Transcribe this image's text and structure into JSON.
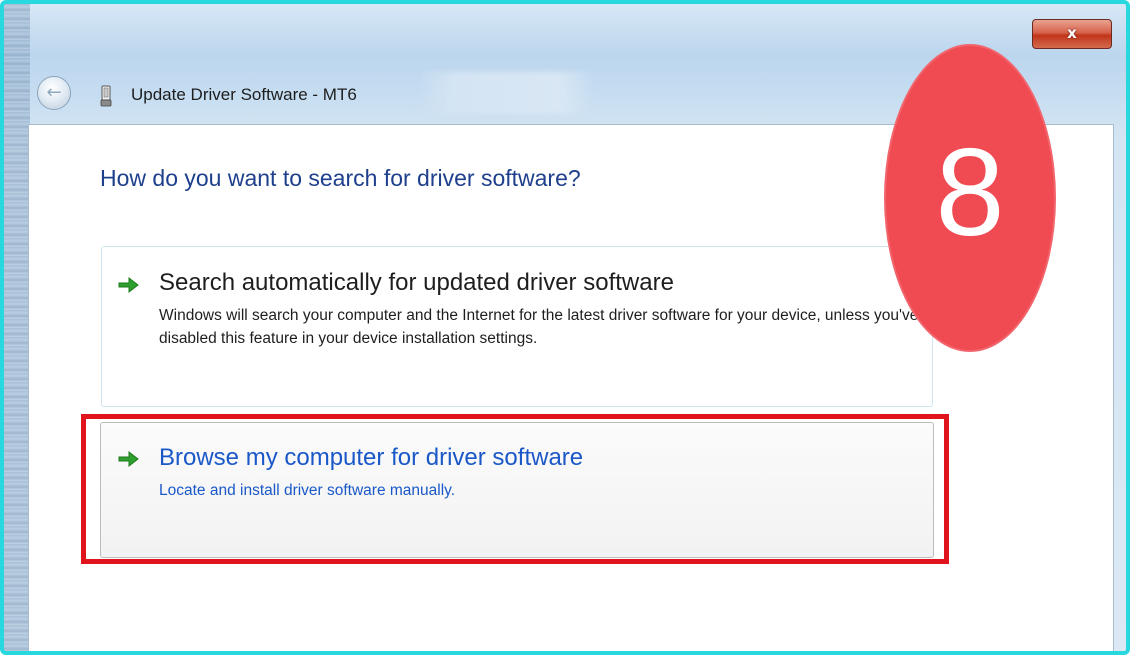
{
  "window": {
    "title": "Update Driver Software - MT6",
    "close_label": "x",
    "back_icon": "back-arrow-icon",
    "device_icon": "usb-device-icon"
  },
  "main": {
    "heading": "How do you want to search for driver software?"
  },
  "options": [
    {
      "title": "Search automatically for updated driver software",
      "description": "Windows will search your computer and the Internet for the latest driver software for your device, unless you've disabled this feature in your device installation settings.",
      "icon": "green-arrow-icon"
    },
    {
      "title": "Browse my computer for driver software",
      "description": "Locate and install driver software manually.",
      "icon": "green-arrow-icon"
    }
  ],
  "annotation": {
    "step_number": "8"
  },
  "colors": {
    "heading": "#1e3f8c",
    "link_blue": "#1a58c8",
    "highlight_red": "#e0141c",
    "badge_red": "#f04b53",
    "frame_cyan": "#28d8df",
    "arrow_green": "#2e9e2e"
  }
}
